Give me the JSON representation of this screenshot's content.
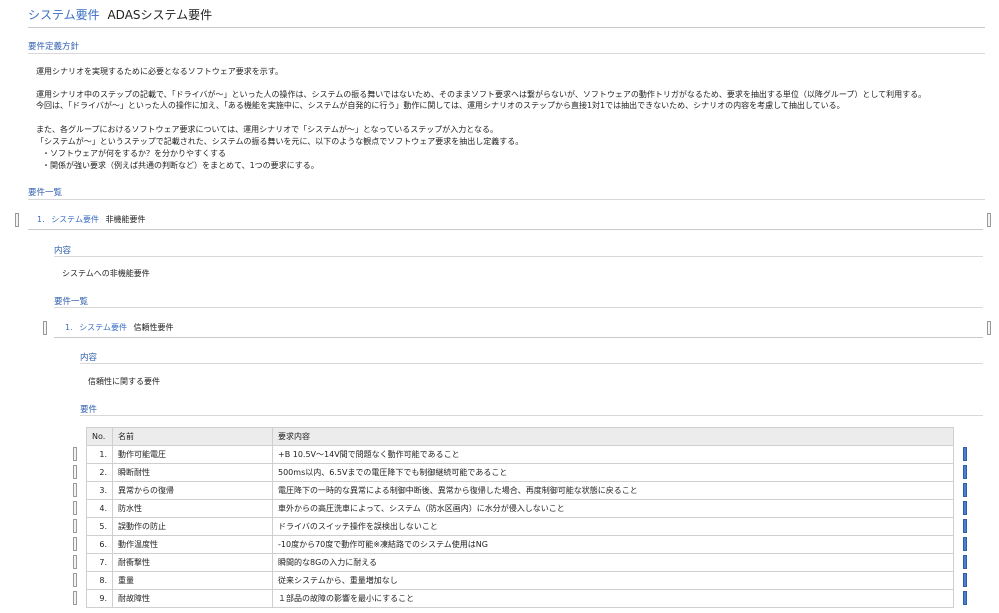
{
  "header": {
    "category": "システム要件",
    "title": "ADASシステム要件"
  },
  "policy": {
    "heading": "要件定義方針",
    "lines": [
      "運用シナリオを実現するために必要となるソフトウェア要求を示す。",
      "運用シナリオ中のステップの記載で、「ドライバが〜」といった人の操作は、システムの振る舞いではないため、そのままソフト要求へは繋がらないが、ソフトウェアの動作トリガがなるため、要求を抽出する単位（以降グループ）として利用する。",
      "今回は、「ドライバが〜」といった人の操作に加え、「ある機能を実施中に、システムが自発的に行う」動作に関しては、運用シナリオのステップから直接1対1では抽出できないため、シナリオの内容を考慮して抽出している。",
      "また、各グループにおけるソフトウェア要求については、運用シナリオで「システムが〜」となっているステップが入力となる。",
      "「システムが〜」というステップで記載された、システムの振る舞いを元に、以下のような観点でソフトウェア要求を抽出し定義する。",
      "・ソフトウェアが何をするか？を分かりやすくする",
      "・関係が強い要求（例えば共通の判断など）をまとめて、1つの要求にする。"
    ]
  },
  "list_heading": "要件一覧",
  "group1": {
    "number": "1.",
    "category": "システム要件",
    "name": "非機能要件",
    "content_heading": "内容",
    "content": "システムへの非機能要件",
    "list_heading": "要件一覧"
  },
  "group2": {
    "number": "1.",
    "category": "システム要件",
    "name": "信頼性要件",
    "content_heading": "内容",
    "content": "信頼性に関する要件",
    "req_heading": "要件"
  },
  "table": {
    "columns": [
      "No.",
      "名前",
      "要求内容"
    ],
    "rows": [
      {
        "no": "1.",
        "name": "動作可能電圧",
        "content": "+B 10.5V〜14V間で問題なく動作可能であること"
      },
      {
        "no": "2.",
        "name": "瞬断耐性",
        "content": "500ms以内、6.5Vまでの電圧降下でも制御継続可能であること"
      },
      {
        "no": "3.",
        "name": "異常からの復帰",
        "content": "電圧降下の一時的な異常による制御中断後、異常から復帰した場合、再度制御可能な状態に戻ること"
      },
      {
        "no": "4.",
        "name": "防水性",
        "content": "車外からの高圧洗車によって、システム（防水区画内）に水分が侵入しないこと"
      },
      {
        "no": "5.",
        "name": "誤動作の防止",
        "content": "ドライバのスイッチ操作を誤検出しないこと"
      },
      {
        "no": "6.",
        "name": "動作温度性",
        "content": "-10度から70度で動作可能※凍結路でのシステム使用はNG"
      },
      {
        "no": "7.",
        "name": "耐衝撃性",
        "content": "瞬間的な8Gの入力に耐える"
      },
      {
        "no": "8.",
        "name": "重量",
        "content": "従来システムから、重量増加なし"
      },
      {
        "no": "9.",
        "name": "耐故障性",
        "content": "１部品の故障の影響を最小にすること"
      }
    ]
  }
}
